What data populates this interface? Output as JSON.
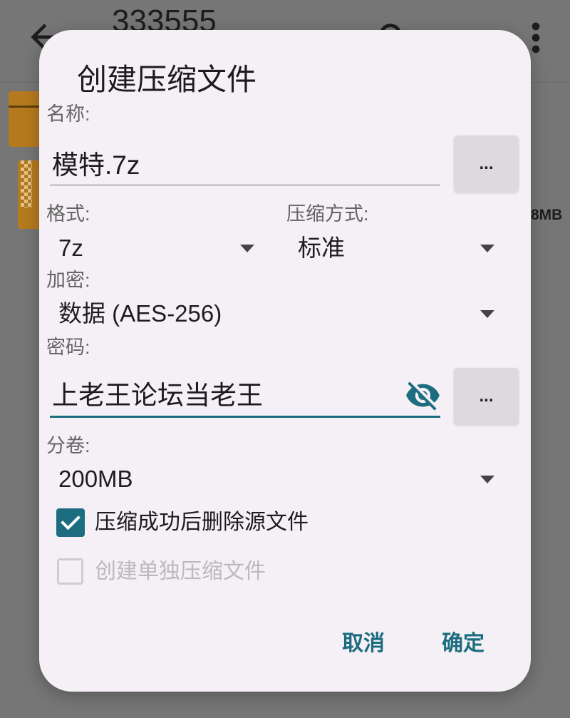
{
  "app_bar": {
    "title": "333555",
    "back_icon": "arrow-back-icon",
    "search_icon": "search-icon",
    "more_icon": "more-vert-icon"
  },
  "file_list": {
    "items": [
      {
        "icon": "archive-icon"
      },
      {
        "icon": "7z-archive-icon",
        "size": "8MB"
      }
    ]
  },
  "dialog": {
    "title": "创建压缩文件",
    "name": {
      "label": "名称:",
      "value": "模特.7z",
      "browse_button": "..."
    },
    "format": {
      "label": "格式:",
      "value": "7z",
      "icon": "dropdown-arrow-icon"
    },
    "compression_method": {
      "label": "压缩方式:",
      "value": "标准",
      "icon": "dropdown-arrow-icon"
    },
    "encryption": {
      "label": "加密:",
      "value": "数据 (AES-256)",
      "icon": "dropdown-arrow-icon"
    },
    "password": {
      "label": "密码:",
      "value": "上老王论坛当老王",
      "toggle_icon": "visibility-off-icon",
      "browse_button": "..."
    },
    "split_volume": {
      "label": "分卷:",
      "value": "200MB",
      "icon": "dropdown-arrow-icon"
    },
    "delete_source": {
      "label": "压缩成功后删除源文件",
      "checked": true,
      "enabled": true
    },
    "separate_archives": {
      "label": "创建单独压缩文件",
      "checked": false,
      "enabled": false
    },
    "actions": {
      "cancel": "取消",
      "confirm": "确定"
    }
  },
  "colors": {
    "accent": "#1b6d7f",
    "dialog_surface": "#f5f0f5",
    "scrim_background": "#767676",
    "archive_orange": "#b57a1e"
  }
}
